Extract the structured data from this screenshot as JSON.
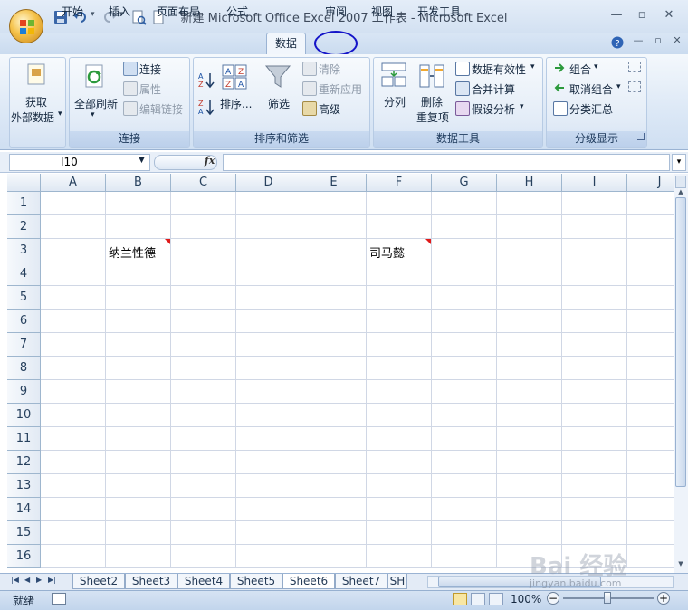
{
  "window": {
    "title": "新建 Microsoft Office Excel 2007 工作表 - Microsoft Excel",
    "minimize_icon": "minimize-icon",
    "restore_icon": "restore-icon",
    "close_icon": "close-icon"
  },
  "tabs": [
    {
      "label": "开始"
    },
    {
      "label": "插入"
    },
    {
      "label": "页面布局"
    },
    {
      "label": "公式"
    },
    {
      "label": "数据",
      "active": true
    },
    {
      "label": "审阅"
    },
    {
      "label": "视图"
    },
    {
      "label": "开发工具"
    }
  ],
  "ribbon": {
    "get_external": {
      "line1": "获取",
      "line2": "外部数据"
    },
    "connections_group": {
      "refresh_all": "全部刷新",
      "connections": "连接",
      "properties": "属性",
      "edit_links": "编辑链接",
      "label": "连接"
    },
    "sort_filter_group": {
      "sort": "排序...",
      "filter": "筛选",
      "clear": "清除",
      "reapply": "重新应用",
      "advanced": "高级",
      "label": "排序和筛选"
    },
    "data_tools_group": {
      "text_to_columns": "分列",
      "remove_duplicates_1": "删除",
      "remove_duplicates_2": "重复项",
      "data_validation": "数据有效性",
      "consolidate": "合并计算",
      "what_if": "假设分析",
      "label": "数据工具"
    },
    "outline_group": {
      "group": "组合",
      "ungroup": "取消组合",
      "subtotal": "分类汇总",
      "label": "分级显示"
    }
  },
  "formula_bar": {
    "name_box": "I10",
    "fx": "fx",
    "formula": ""
  },
  "grid": {
    "columns": [
      "A",
      "B",
      "C",
      "D",
      "E",
      "F",
      "G",
      "H",
      "I",
      "J"
    ],
    "rows": [
      "1",
      "2",
      "3",
      "4",
      "5",
      "6",
      "7",
      "8",
      "9",
      "10",
      "11",
      "12",
      "13",
      "14",
      "15",
      "16"
    ],
    "cells": {
      "B3": "纳兰性德",
      "F3": "司马懿"
    }
  },
  "sheet_tabs": [
    "Sheet2",
    "Sheet3",
    "Sheet4",
    "Sheet5",
    "Sheet6",
    "Sheet7",
    "SH"
  ],
  "active_sheet": "Sheet6",
  "status": {
    "ready": "就绪",
    "zoom": "100%"
  },
  "watermark": {
    "main": "Bai 经验",
    "sub": "jingyan.baidu.com"
  }
}
